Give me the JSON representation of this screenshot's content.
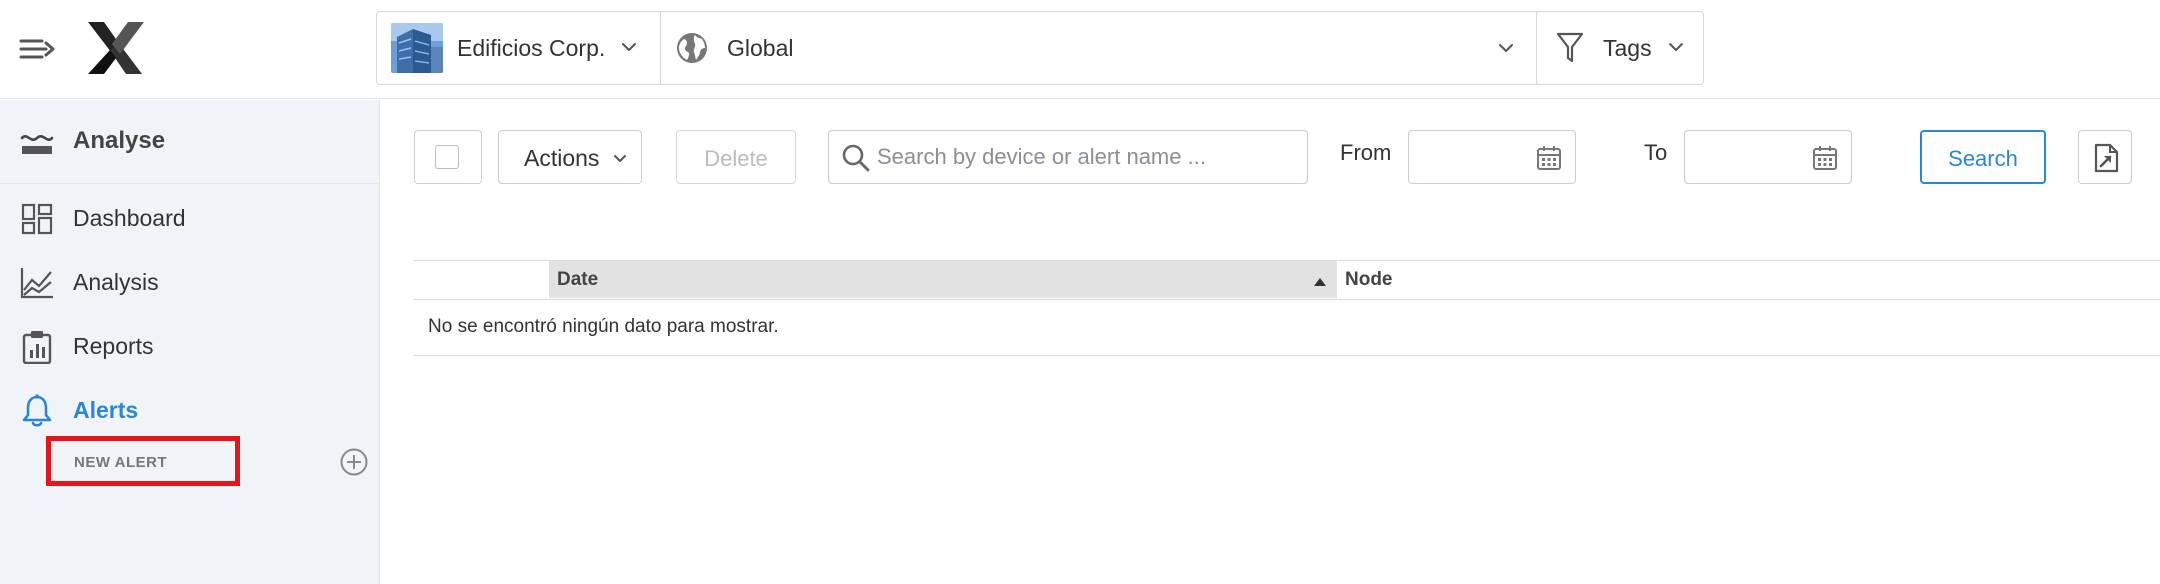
{
  "header": {
    "company": {
      "label": "Edificios Corp."
    },
    "scope": {
      "label": "Global"
    },
    "tags": {
      "label": "Tags"
    }
  },
  "sidebar": {
    "section_title": "Analyse",
    "items": [
      {
        "label": "Dashboard",
        "icon": "dashboard-icon"
      },
      {
        "label": "Analysis",
        "icon": "analysis-chart-icon"
      },
      {
        "label": "Reports",
        "icon": "reports-clipboard-icon"
      },
      {
        "label": "Alerts",
        "icon": "bell-icon",
        "active": true
      }
    ],
    "new_alert_label": "NEW ALERT"
  },
  "toolbar": {
    "actions_label": "Actions",
    "delete_label": "Delete",
    "search_placeholder": "Search by device or alert name ...",
    "from_label": "From",
    "to_label": "To",
    "search_button_label": "Search"
  },
  "table": {
    "columns": [
      "Date",
      "Node"
    ],
    "sorted_column": "Date",
    "sort_direction": "ascending",
    "empty_message": "No se encontró ningún dato para mostrar."
  },
  "colors": {
    "accent": "#2b86d6",
    "sidebar_bg": "#f1f4f7",
    "highlight_border": "#e8141c"
  }
}
